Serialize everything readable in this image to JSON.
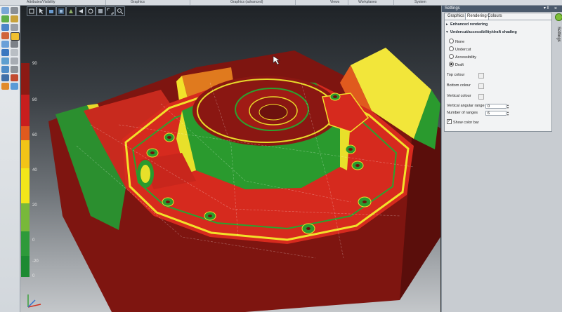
{
  "ribbon": {
    "groups": [
      "Attributes/Visibility",
      "Graphics",
      "Graphics (advanced)",
      "Views",
      "Workplanes",
      "System"
    ]
  },
  "colorbar": {
    "labels": [
      "90",
      "80",
      "60",
      "40",
      "20",
      "0",
      "-20",
      "0"
    ],
    "colors": [
      "#8c1a14",
      "#c81e1e",
      "#e05a1e",
      "#f2c417",
      "#f2e61a",
      "#78b83a",
      "#2e9a3a",
      "#1d8a32"
    ]
  },
  "settings": {
    "title": "Settings",
    "close": "×",
    "pin": "▾ ‖",
    "side_tab": "Settings",
    "tabs": [
      "Graphics",
      "Rendering",
      "Colours"
    ],
    "active_tab": "Rendering",
    "section_enhanced": "Enhanced rendering",
    "section_shading": "Undercut/accessibility/draft shading",
    "arrow_collapsed": "▸",
    "arrow_expanded": "▾",
    "options": [
      "None",
      "Undercut",
      "Accessibility",
      "Draft"
    ],
    "selected": "Draft",
    "top_colour": "Top colour",
    "bottom_colour": "Bottom colour",
    "vertical_colour": "Vertical colour",
    "vertical_angular_range_label": "Vertical angular range",
    "vertical_angular_range_value": "0",
    "number_of_ranges_label": "Number of ranges",
    "number_of_ranges_value": "6",
    "show_color_bar": "Show color bar",
    "show_color_bar_checked": true
  },
  "colors": {
    "draft_red": "#d42a1e",
    "draft_green": "#2a9a2e",
    "draft_yellow": "#f2e12a",
    "draft_orange": "#e6791e",
    "dark_red": "#8a1712",
    "panel_title_bg": "#4b5a6c"
  }
}
